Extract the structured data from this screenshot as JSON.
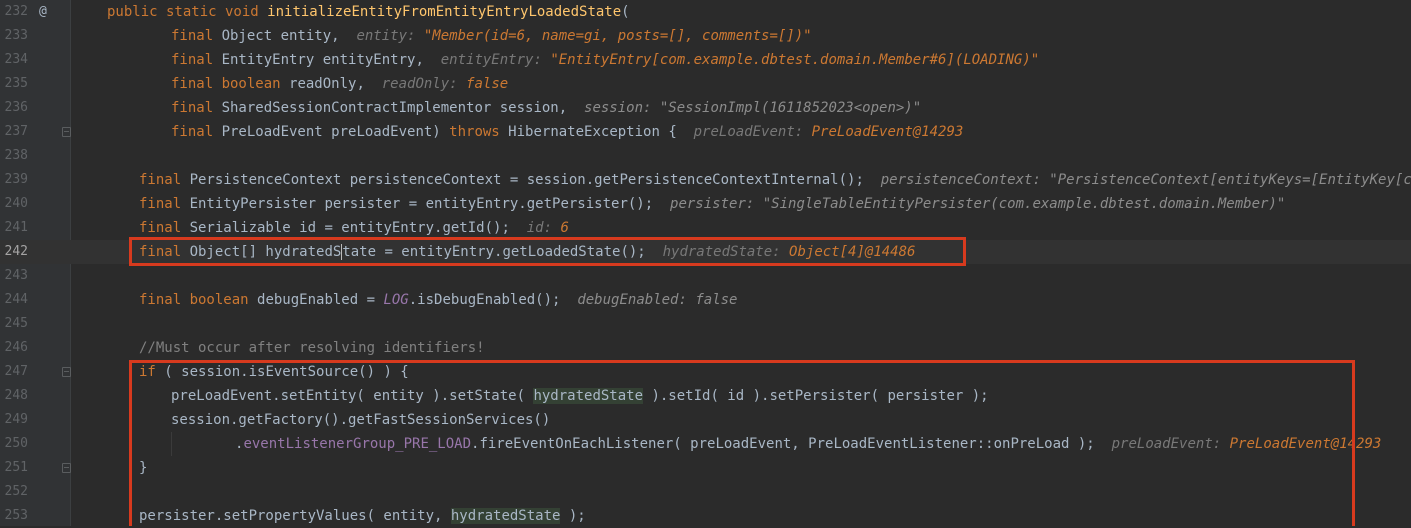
{
  "editor": {
    "at_marker": "@",
    "lines": [
      {
        "no": "232",
        "tokens": [
          {
            "t": "public static void ",
            "c": "kw"
          },
          {
            "t": "initializeEntityFromEntityEntryLoadedState",
            "c": "fn"
          },
          {
            "t": "(",
            "c": ""
          }
        ]
      },
      {
        "no": "233",
        "tokens": [
          {
            "t": "final ",
            "c": "kw"
          },
          {
            "t": "Object entity,  ",
            "c": ""
          },
          {
            "t": "entity: ",
            "c": "hint-name"
          },
          {
            "t": "\"Member(id=6, name=gi, posts=[], comments=[])\"",
            "c": "hint-val"
          }
        ]
      },
      {
        "no": "234",
        "tokens": [
          {
            "t": "final ",
            "c": "kw"
          },
          {
            "t": "EntityEntry entityEntry,  ",
            "c": ""
          },
          {
            "t": "entityEntry: ",
            "c": "hint-name"
          },
          {
            "t": "\"EntityEntry[com.example.dbtest.domain.Member#6](LOADING)\"",
            "c": "hint-val"
          }
        ]
      },
      {
        "no": "235",
        "tokens": [
          {
            "t": "final boolean ",
            "c": "kw"
          },
          {
            "t": "readOnly,  ",
            "c": ""
          },
          {
            "t": "readOnly: ",
            "c": "hint-name"
          },
          {
            "t": "false",
            "c": "hint-val"
          }
        ]
      },
      {
        "no": "236",
        "tokens": [
          {
            "t": "final ",
            "c": "kw"
          },
          {
            "t": "SharedSessionContractImplementor session,  ",
            "c": ""
          },
          {
            "t": "session: \"SessionImpl(1611852023<open>)\"",
            "c": "hint-plain"
          }
        ]
      },
      {
        "no": "237",
        "tokens": [
          {
            "t": "final ",
            "c": "kw"
          },
          {
            "t": "PreLoadEvent preLoadEvent) ",
            "c": ""
          },
          {
            "t": "throws ",
            "c": "kw"
          },
          {
            "t": "HibernateException {  ",
            "c": ""
          },
          {
            "t": "preLoadEvent: ",
            "c": "hint-name"
          },
          {
            "t": "PreLoadEvent@14293",
            "c": "hint-val"
          }
        ]
      },
      {
        "no": "238",
        "tokens": []
      },
      {
        "no": "239",
        "tokens": [
          {
            "t": "final ",
            "c": "kw"
          },
          {
            "t": "PersistenceContext persistenceContext = session.getPersistenceContextInternal();  ",
            "c": ""
          },
          {
            "t": "persistenceContext: \"PersistenceContext[entityKeys=[EntityKey[com.examp",
            "c": "hint-plain"
          }
        ]
      },
      {
        "no": "240",
        "tokens": [
          {
            "t": "final ",
            "c": "kw"
          },
          {
            "t": "EntityPersister persister = entityEntry.getPersister();  ",
            "c": ""
          },
          {
            "t": "persister: \"SingleTableEntityPersister(com.example.dbtest.domain.Member)\"",
            "c": "hint-plain"
          }
        ]
      },
      {
        "no": "241",
        "tokens": [
          {
            "t": "final ",
            "c": "kw"
          },
          {
            "t": "Serializable id = entityEntry.getId();  ",
            "c": ""
          },
          {
            "t": "id: ",
            "c": "hint-name"
          },
          {
            "t": "6",
            "c": "hint-val"
          }
        ]
      },
      {
        "no": "242",
        "tokens": [
          {
            "t": "final ",
            "c": "kw"
          },
          {
            "t": "Object[] hydratedS",
            "c": ""
          },
          {
            "t": "tate = entityEntry.getLoadedState();  ",
            "c": "caret"
          },
          {
            "t": "hydratedState: ",
            "c": "hint-name"
          },
          {
            "t": "Object[4]@14486",
            "c": "hint-val"
          }
        ]
      },
      {
        "no": "243",
        "tokens": []
      },
      {
        "no": "244",
        "tokens": [
          {
            "t": "final boolean ",
            "c": "kw"
          },
          {
            "t": "debugEnabled = ",
            "c": ""
          },
          {
            "t": "LOG",
            "c": "const"
          },
          {
            "t": ".isDebugEnabled();  ",
            "c": ""
          },
          {
            "t": "debugEnabled: false",
            "c": "hint-plain"
          }
        ]
      },
      {
        "no": "245",
        "tokens": []
      },
      {
        "no": "246",
        "tokens": [
          {
            "t": "//Must occur after resolving identifiers!",
            "c": "cm"
          }
        ]
      },
      {
        "no": "247",
        "tokens": [
          {
            "t": "if ",
            "c": "kw"
          },
          {
            "t": "( session.isEventSource() ) {",
            "c": ""
          }
        ]
      },
      {
        "no": "248",
        "tokens": [
          {
            "t": "preLoadEvent.setEntity( entity ).setState( ",
            "c": ""
          },
          {
            "t": "hydratedState",
            "c": "hl-var"
          },
          {
            "t": " ).setId( id ).setPersister( persister );",
            "c": ""
          }
        ]
      },
      {
        "no": "249",
        "tokens": [
          {
            "t": "session.getFactory().getFastSessionServices()",
            "c": ""
          }
        ]
      },
      {
        "no": "250",
        "tokens": [
          {
            "t": ".",
            "c": ""
          },
          {
            "t": "eventListenerGroup_PRE_LOAD",
            "c": "field"
          },
          {
            "t": ".fireEventOnEachListener( preLoadEvent, PreLoadEventListener::onPreLoad );  ",
            "c": ""
          },
          {
            "t": "preLoadEvent: ",
            "c": "hint-name"
          },
          {
            "t": "PreLoadEvent@14293",
            "c": "hint-val"
          }
        ]
      },
      {
        "no": "251",
        "tokens": [
          {
            "t": "}",
            "c": ""
          }
        ]
      },
      {
        "no": "252",
        "tokens": []
      },
      {
        "no": "253",
        "tokens": [
          {
            "t": "persister.setPropertyValues( entity, ",
            "c": ""
          },
          {
            "t": "hydratedState",
            "c": "hl-var"
          },
          {
            "t": " );",
            "c": ""
          }
        ]
      }
    ]
  }
}
